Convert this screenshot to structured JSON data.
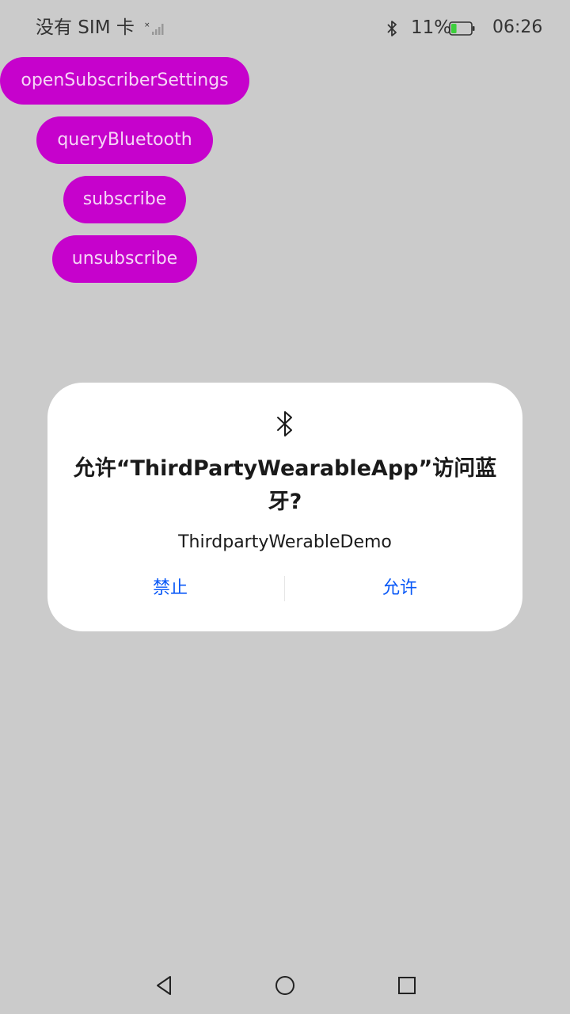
{
  "status_bar": {
    "carrier": "没有 SIM 卡",
    "battery_percent": "11%",
    "battery_level": 0.11,
    "time": "06:26"
  },
  "buttons": [
    {
      "label": "openSubscriberSettings"
    },
    {
      "label": "queryBluetooth"
    },
    {
      "label": "subscribe"
    },
    {
      "label": "unsubscribe"
    }
  ],
  "dialog": {
    "icon": "bluetooth-icon",
    "title": "允许“ThirdPartyWearableApp”访问蓝牙?",
    "message": "ThirdpartyWerableDemo",
    "deny_label": "禁止",
    "allow_label": "允许"
  },
  "nav_bar": {
    "icons": [
      "back-icon",
      "home-icon",
      "recents-icon"
    ]
  },
  "colors": {
    "background": "#cbcbcb",
    "button_bg": "#c602cc",
    "button_text": "#f6d6f7",
    "dialog_bg": "#ffffff",
    "action_text": "#0a59f7"
  }
}
